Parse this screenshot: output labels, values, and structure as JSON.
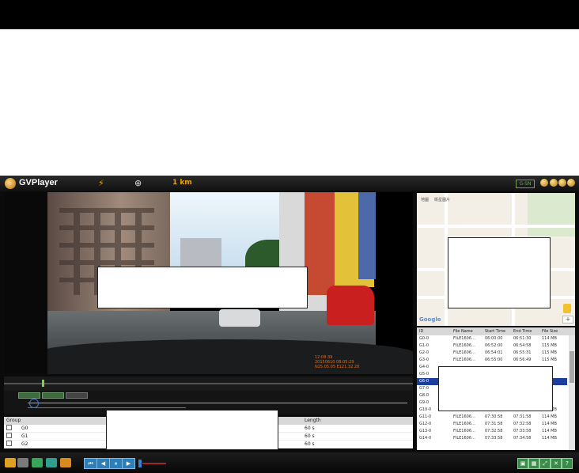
{
  "app": {
    "title": "GVPlayer",
    "speed": "1 km",
    "gsensor": "G-SN",
    "compass_icon": "compass-icon",
    "satellite_icon": "satellite-icon"
  },
  "video": {
    "osd": [
      "12:08:39",
      "20150610 08:05:29",
      "N25.05.05 E121.32.28"
    ]
  },
  "group_grid": {
    "headers": [
      "Group",
      "Length"
    ],
    "rows": [
      {
        "group": "G0",
        "length": "60 s"
      },
      {
        "group": "G1",
        "length": "60 s"
      },
      {
        "group": "G2",
        "length": "60 s"
      }
    ]
  },
  "map": {
    "labels": [
      "地圖",
      "衛星圖片"
    ],
    "zoom_in": "+",
    "zoom_out": "−",
    "provider": "Google"
  },
  "file_list": {
    "headers": [
      "ID",
      "File Name",
      "Start Time",
      "End Time",
      "File Size"
    ],
    "rows": [
      {
        "id": "G0-0",
        "name": "FILE1606...",
        "start": "06:00:00",
        "end": "06:51:30",
        "size": "114 MB"
      },
      {
        "id": "G1-0",
        "name": "FILE1606...",
        "start": "06:52:00",
        "end": "06:54:58",
        "size": "115 MB"
      },
      {
        "id": "G2-0",
        "name": "FILE1606...",
        "start": "06:54:01",
        "end": "06:55:31",
        "size": "115 MB"
      },
      {
        "id": "G3-0",
        "name": "FILE1606...",
        "start": "06:55:00",
        "end": "06:56:49",
        "size": "115 MB"
      },
      {
        "id": "G4-0",
        "name": "",
        "start": "",
        "end": "",
        "size": ""
      },
      {
        "id": "G5-0",
        "name": "",
        "start": "",
        "end": "",
        "size": ""
      },
      {
        "id": "G6-0",
        "name": "",
        "start": "",
        "end": "",
        "size": ""
      },
      {
        "id": "G7-0",
        "name": "",
        "start": "",
        "end": "",
        "size": ""
      },
      {
        "id": "G8-0",
        "name": "",
        "start": "",
        "end": "",
        "size": ""
      },
      {
        "id": "G9-0",
        "name": "",
        "start": "",
        "end": "",
        "size": ""
      },
      {
        "id": "G10-0",
        "name": "FILE1606...",
        "start": "07:29:58",
        "end": "07:30:38",
        "size": "114 MB"
      },
      {
        "id": "G11-0",
        "name": "FILE1606...",
        "start": "07:30:58",
        "end": "07:31:58",
        "size": "114 MB"
      },
      {
        "id": "G12-0",
        "name": "FILE1606...",
        "start": "07:31:58",
        "end": "07:32:58",
        "size": "114 MB"
      },
      {
        "id": "G13-0",
        "name": "FILE1606...",
        "start": "07:32:58",
        "end": "07:33:58",
        "size": "114 MB"
      },
      {
        "id": "G14-0",
        "name": "FILE1606...",
        "start": "07:33:58",
        "end": "07:34:58",
        "size": "114 MB"
      }
    ]
  },
  "bottom": {
    "icons": [
      "open-folder-icon",
      "settings-icon",
      "export-icon",
      "snapshot-icon",
      "map-icon"
    ],
    "playback": [
      "⏮",
      "◀",
      "⏸",
      "▶"
    ],
    "right_icons": [
      "▣",
      "▦",
      "⤢",
      "✕",
      "?"
    ]
  },
  "colors": {
    "accent": "#f0a400",
    "selected_row": "#1b3f9a",
    "osd_text": "#e06a1a"
  }
}
